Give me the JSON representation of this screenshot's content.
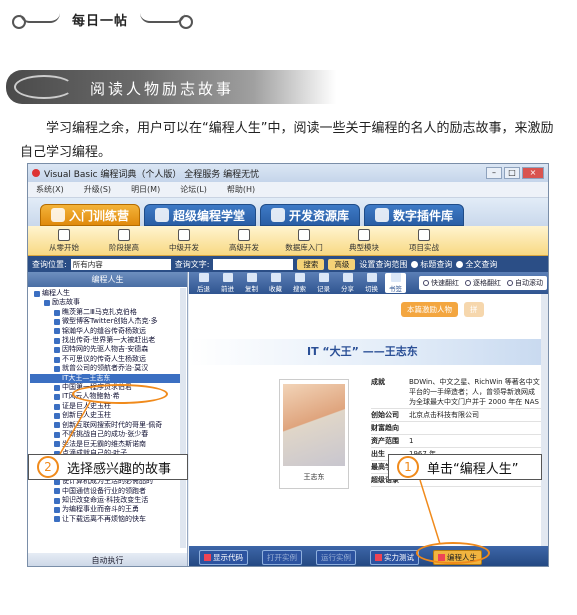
{
  "header": {
    "title": "每日一帖"
  },
  "section": {
    "title": "阅读人物励志故事"
  },
  "intro": {
    "text": "学习编程之余，用户可以在“编程人生”中，阅读一些关于编程的名人的励志故事，来激励自己学习编程。"
  },
  "app": {
    "title": "Visual Basic 编程词典（个人版）  全程服务  编程无忧",
    "menu": [
      "系统(X)",
      "升级(S)",
      "明日(M)",
      "论坛(L)",
      "帮助(H)"
    ],
    "tabs": [
      "入门训练营",
      "超级编程学堂",
      "开发资源库",
      "数字插件库"
    ],
    "icons": [
      "从零开始",
      "阶段提高",
      "中级开发",
      "高级开发",
      "数据库入门",
      "典型模块",
      "项目实战"
    ],
    "query": {
      "position_label": "查询位置:",
      "position_value": "所有内容",
      "text_label": "查询文字:",
      "search_btn": "搜索",
      "advanced_btn": "高级",
      "settings_label": "设置查询范围",
      "opt1": "标题查询",
      "opt2": "全文查询"
    },
    "left": {
      "header": "编程人生",
      "footer": "自动执行",
      "tree": [
        "编程人生",
        "励志故事",
        "瞧茨第二Ⅲ马克扎克伯格",
        "微型博客Twitter创始人杰克·多",
        "锦瀚华人的缝谷传奇杨致远",
        "找出传奇·世界第一大被赶出老",
        "因特网的先驱人物吉·安德森",
        "不可思议的传奇人生杨致远",
        "就曾公司的领航者乔治·莫汉",
        "IT大王—王志东",
        "中国第一程序员求伯君",
        "IT风云人物鲍勃·希",
        "证是巨人史玉柱",
        "创新巨人史玉柱",
        "创新互联网搜索时代的哥里·佩奇",
        "不断挑战自己的成功·张少春",
        "坐法是巨无霸的维杰斯诺南",
        "点滴成就自己的·叶子",
        "为Java技术之父詹姆斯·高斯林",
        "石破Java技术之父帕尔默",
        "使计算机成为生活的必需品的",
        "中国通信设备行业的领跑者",
        "知识改变命运·科技改变生活",
        "为编程事业而奋斗的王勇",
        "让下载远离不再烦恼的快车"
      ],
      "selected_index": 9
    },
    "toolbar": [
      "后退",
      "前进",
      "复制",
      "收藏",
      "搜索",
      "记录",
      "分享",
      "切换",
      "书签"
    ],
    "toolbar_options": [
      "快速翻红",
      "逐格翻红",
      "自动滚动"
    ],
    "content": {
      "tab1": "本篇激励人物",
      "tab2": "拼",
      "headline": "IT “大王” ——王志东",
      "caption": "王志东",
      "info": [
        {
          "k": "成就",
          "v": "BDWin、中文之星、RichWin 等著名中文平台的一手缔造者；人，曾领导新浪网成为全球最大中文门户并于 2000 年在 NAS"
        },
        {
          "k": "创始公司",
          "v": "北京点击科技有限公司"
        },
        {
          "k": "财富趋向",
          "v": ""
        },
        {
          "k": "资产范围",
          "v": "1"
        },
        {
          "k": "出生",
          "v": "1967 年"
        },
        {
          "k": "最高学历",
          "v": "博士"
        },
        {
          "k": "超级语录",
          "v": ""
        }
      ]
    },
    "bottom": [
      "显示代码",
      "打开实例",
      "运行实例",
      "实力测试",
      "编程人生"
    ]
  },
  "callout1": {
    "num": "1",
    "text": "单击“编程人生”"
  },
  "callout2": {
    "num": "2",
    "text": "选择感兴趣的故事"
  },
  "colors": {
    "accent": "#f08a1b",
    "blue": "#2a5ea5"
  }
}
